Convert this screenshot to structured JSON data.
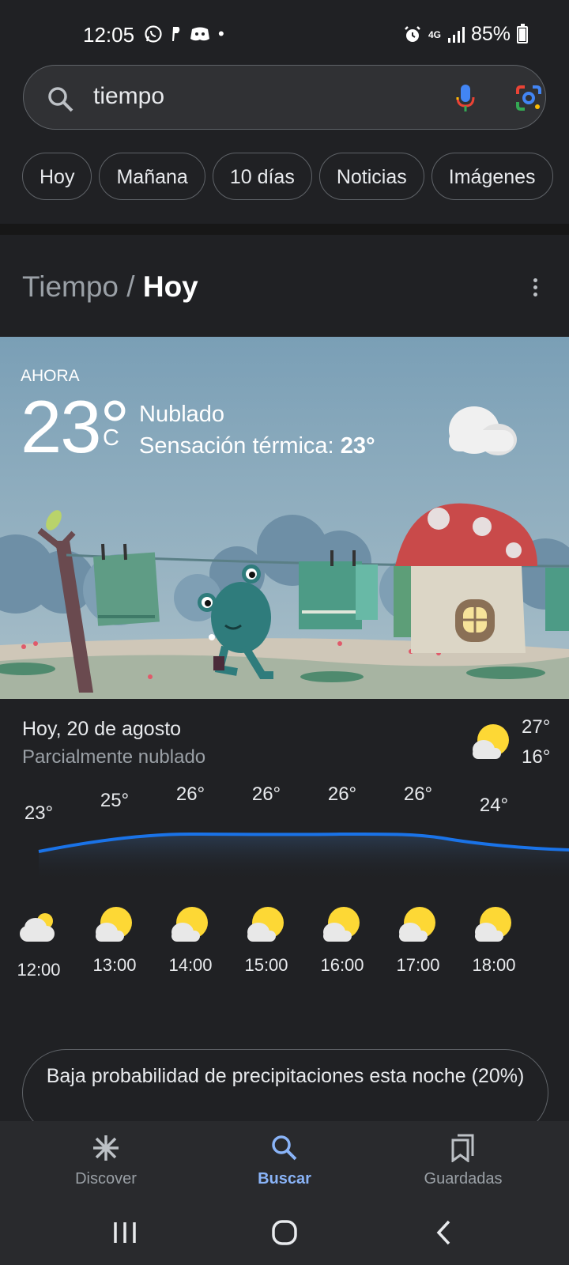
{
  "status": {
    "time": "12:05",
    "battery": "85%",
    "network": "4G",
    "battery_level": 0.85
  },
  "search": {
    "query": "tiempo"
  },
  "chips": [
    "Hoy",
    "Mañana",
    "10 días",
    "Noticias",
    "Imágenes"
  ],
  "header": {
    "crumb": "Tiempo",
    "separator": "/",
    "current": "Hoy"
  },
  "now": {
    "label": "AHORA",
    "temp": "23°",
    "unit": "C",
    "condition": "Nublado",
    "feels_label": "Sensación térmica:",
    "feels_value": "23°"
  },
  "today": {
    "date": "Hoy, 20 de agosto",
    "summary": "Parcialmente nublado",
    "high": "27°",
    "low": "16°"
  },
  "hourly": [
    {
      "time": "12:00",
      "temp": "23°",
      "icon": "cloudy-icon"
    },
    {
      "time": "13:00",
      "temp": "25°",
      "icon": "partly-cloudy-icon"
    },
    {
      "time": "14:00",
      "temp": "26°",
      "icon": "partly-cloudy-icon"
    },
    {
      "time": "15:00",
      "temp": "26°",
      "icon": "partly-cloudy-icon"
    },
    {
      "time": "16:00",
      "temp": "26°",
      "icon": "partly-cloudy-icon"
    },
    {
      "time": "17:00",
      "temp": "26°",
      "icon": "partly-cloudy-icon"
    },
    {
      "time": "18:00",
      "temp": "24°",
      "icon": "partly-cloudy-icon"
    }
  ],
  "precip_note": "Baja probabilidad de precipitaciones esta noche (20%)",
  "nav": {
    "discover": "Discover",
    "search": "Buscar",
    "saved": "Guardadas"
  },
  "colors": {
    "accent": "#8ab4f8",
    "temp_line": "#1a73e8",
    "background": "#202124"
  }
}
